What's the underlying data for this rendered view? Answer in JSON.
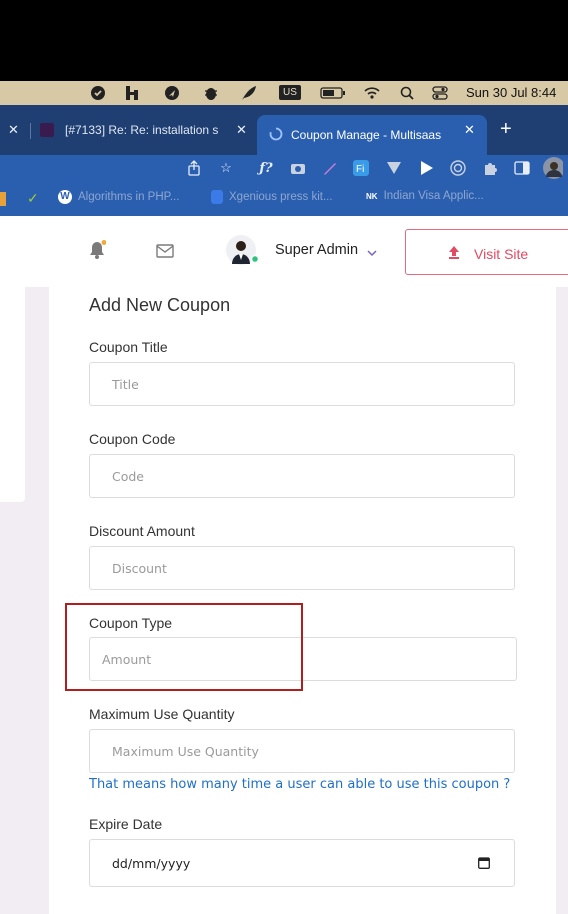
{
  "menubar": {
    "status_icons": [
      "shield-check-icon",
      "h-app-icon",
      "navigation-icon",
      "bug-icon",
      "feather-icon",
      "keyboard-layout-icon",
      "battery-icon",
      "wifi-icon",
      "search-icon",
      "control-center-icon"
    ],
    "input_source": "US",
    "clock": "Sun 30 Jul  8:44"
  },
  "tabs": [
    {
      "label": "[#7133] Re: Re: installation s",
      "active": false
    },
    {
      "label": "Coupon Manage - Multisaas",
      "active": true
    }
  ],
  "toolbar": {
    "icons": [
      "share-icon",
      "star-icon",
      "fonts-ext-icon",
      "camera-ext-icon",
      "pen-ext-icon",
      "fi-ext-icon",
      "v-ext-icon",
      "play-ext-icon",
      "target-ext-icon",
      "puzzle-extensions-icon",
      "sidebar-toggle-icon",
      "profile-avatar"
    ]
  },
  "bookmarks": [
    {
      "label": "Algorithms in PHP..."
    },
    {
      "label": "Xgenious press kit..."
    },
    {
      "label": "Indian Visa Applic..."
    }
  ],
  "header": {
    "user_name": "Super Admin",
    "visit_site_label": "Visit Site"
  },
  "form": {
    "title": "Add New Coupon",
    "coupon_title_label": "Coupon Title",
    "coupon_title_placeholder": "Title",
    "coupon_code_label": "Coupon Code",
    "coupon_code_placeholder": "Code",
    "discount_label": "Discount Amount",
    "discount_placeholder": "Discount",
    "coupon_type_label": "Coupon Type",
    "coupon_type_placeholder": "Amount",
    "max_use_label": "Maximum Use Quantity",
    "max_use_placeholder": "Maximum Use Quantity",
    "max_use_hint": "That means how many time a user can able to use this coupon ?",
    "expire_label": "Expire Date",
    "expire_placeholder": "dd/mm/yyyy"
  },
  "colors": {
    "highlight": "#b21e1e",
    "accent": "#e24a64",
    "hint": "#1f6fc9",
    "tab_bar": "#1f3f73",
    "toolbar": "#2a5fb0"
  }
}
